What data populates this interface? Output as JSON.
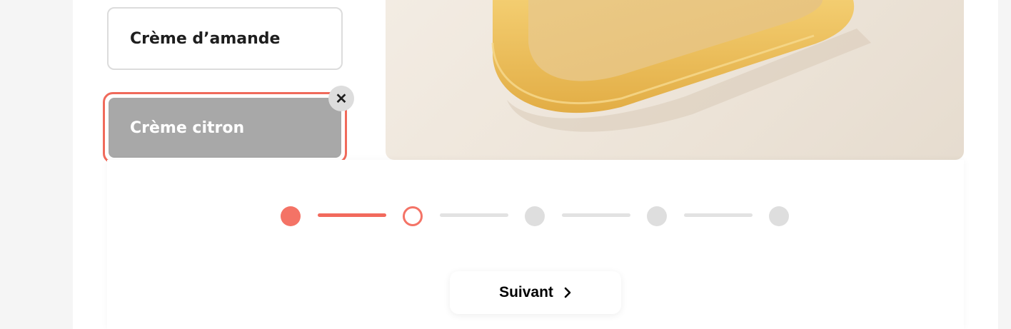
{
  "options": [
    {
      "label": "Crème d’amande",
      "selected": false
    },
    {
      "label": "Crème citron",
      "selected": true
    }
  ],
  "remove_button": {
    "label": "✕",
    "icon": "close-icon"
  },
  "photo": {
    "subject": "tart-shell-photo"
  },
  "stepper": {
    "total_steps": 5,
    "current_step": 2,
    "colors": {
      "accent": "#f47366",
      "inactive": "#dedede"
    }
  },
  "next_button": {
    "label": "Suivant",
    "icon": "chevron-right-icon"
  }
}
